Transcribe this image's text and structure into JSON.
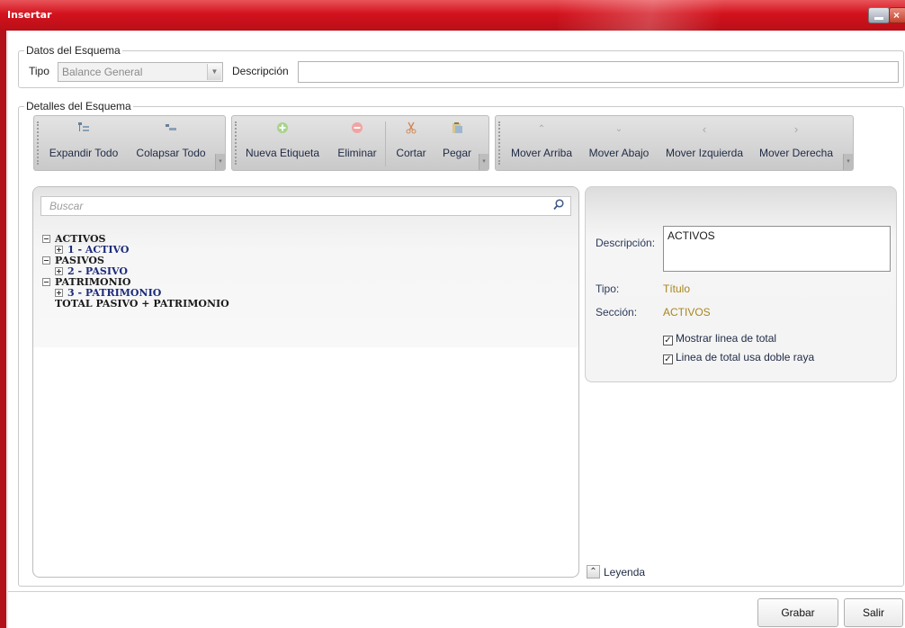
{
  "window": {
    "title": "Insertar"
  },
  "schema_data": {
    "legend": "Datos del Esquema",
    "tipo_label": "Tipo",
    "tipo_value": "Balance General",
    "descripcion_label": "Descripción",
    "descripcion_value": ""
  },
  "schema_details": {
    "legend": "Detalles del Esquema"
  },
  "toolbar": {
    "expand_all": "Expandir Todo",
    "collapse_all": "Colapsar Todo",
    "new_label": "Nueva Etiqueta",
    "delete": "Eliminar",
    "cut": "Cortar",
    "paste": "Pegar",
    "move_up": "Mover Arriba",
    "move_down": "Mover Abajo",
    "move_left": "Mover Izquierda",
    "move_right": "Mover Derecha"
  },
  "search": {
    "placeholder": "Buscar"
  },
  "tree": {
    "nodes": [
      {
        "label": "ACTIVOS",
        "level": 0,
        "expanded": true,
        "selected": true
      },
      {
        "label": "1 - ACTIVO",
        "level": 1,
        "expanded": false
      },
      {
        "label": "PASIVOS",
        "level": 0,
        "expanded": true
      },
      {
        "label": "2 - PASIVO",
        "level": 1,
        "expanded": false
      },
      {
        "label": "PATRIMONIO",
        "level": 0,
        "expanded": true
      },
      {
        "label": "3 - PATRIMONIO",
        "level": 1,
        "expanded": false
      },
      {
        "label": "TOTAL PASIVO + PATRIMONIO",
        "level": 0
      }
    ]
  },
  "details": {
    "descripcion_label": "Descripción:",
    "descripcion_value": "ACTIVOS",
    "tipo_label": "Tipo:",
    "tipo_value": "Título",
    "seccion_label": "Sección:",
    "seccion_value": "ACTIVOS",
    "show_total_line": {
      "label": "Mostrar linea de total",
      "checked": true
    },
    "double_line": {
      "label": "Linea de total usa doble raya",
      "checked": true
    }
  },
  "legend_toggle": "Leyenda",
  "actions": {
    "save": "Grabar",
    "exit": "Salir"
  },
  "colors": {
    "titlebar": "#d3121d",
    "value_text": "#a8861e",
    "tree_child": "#1c2b7a"
  }
}
